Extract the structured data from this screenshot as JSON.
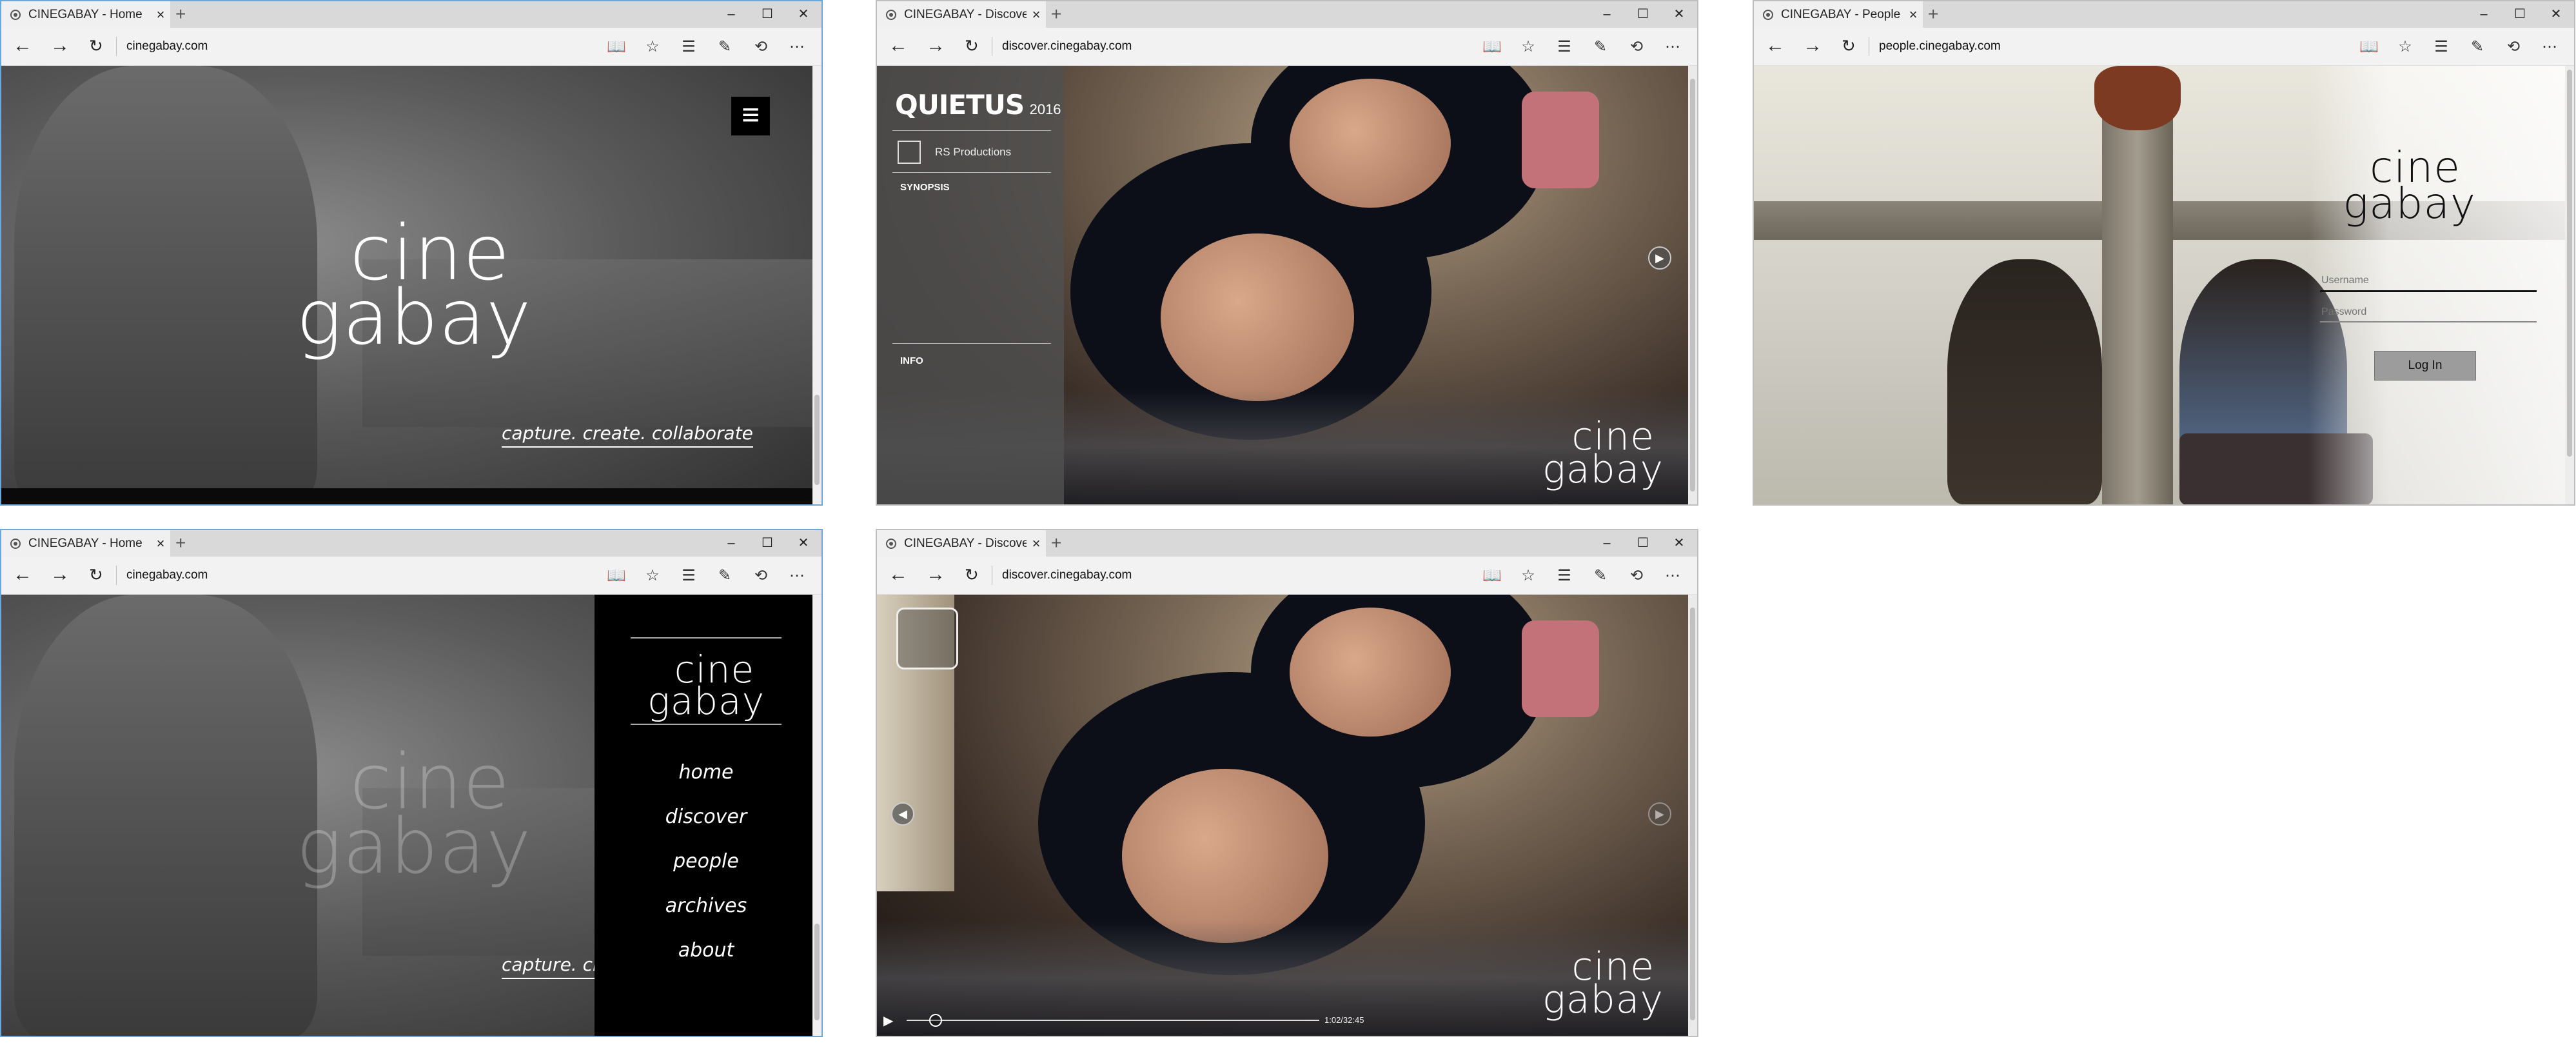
{
  "browser": {
    "new_tab": "+",
    "window_controls": {
      "minimize": "–",
      "maximize": "☐",
      "close": "✕"
    },
    "nav_icons": {
      "back": "←",
      "forward": "→",
      "refresh": "↻"
    },
    "toolbar_icons": {
      "reading_view": "📖",
      "favorite": "☆",
      "hub": "☰",
      "web_note": "✎",
      "share": "⟲",
      "more": "⋯"
    },
    "tab_close": "×"
  },
  "win1": {
    "tab_title": "CINEGABAY - Home",
    "url": "cinegabay.com",
    "logo_line1": "cine",
    "logo_line2": "gabay",
    "tagline": "capture. create. collaborate",
    "menu_icon": "≡"
  },
  "win2": {
    "tab_title": "CINEGABAY - Discove",
    "url": "discover.cinegabay.com",
    "film_title": "QUIETUS",
    "film_year": "2016",
    "production": "RS Productions",
    "synopsis_label": "SYNOPSIS",
    "info_label": "INFO",
    "logo_line1": "cine",
    "logo_line2": "gabay",
    "next_arrow": "▶"
  },
  "win3": {
    "tab_title": "CINEGABAY - People",
    "url": "people.cinegabay.com",
    "logo_line1": "cine",
    "logo_line2": "gabay",
    "username_placeholder": "Username",
    "password_placeholder": "Password",
    "login_label": "Log In"
  },
  "win4": {
    "tab_title": "CINEGABAY - Home",
    "url": "cinegabay.com",
    "logo_line1": "cine",
    "logo_line2": "gabay",
    "tagline": "capture. cre",
    "menu_logo_line1": "cine",
    "menu_logo_line2": "gabay",
    "menu_items": [
      "home",
      "discover",
      "people",
      "archives",
      "about"
    ]
  },
  "win5": {
    "tab_title": "CINEGABAY - Discove",
    "url": "discover.cinegabay.com",
    "logo_line1": "cine",
    "logo_line2": "gabay",
    "prev_arrow": "◀",
    "next_arrow": "▶",
    "play_icon": "▶",
    "time": "1:02/32:45",
    "progress": 0.07
  }
}
